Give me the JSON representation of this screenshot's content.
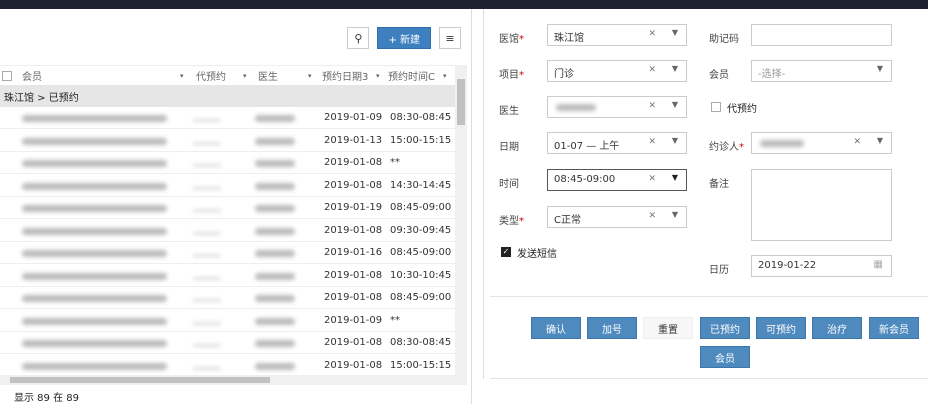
{
  "toolbar": {
    "new_label": "+ 新建"
  },
  "table": {
    "headers": [
      "会员",
      "代预约",
      "医生",
      "预约日期3",
      "预约时间C"
    ],
    "group": "珠江馆 > 已预约",
    "rows": [
      {
        "date": "2019-01-09",
        "time": "08:30-08:45"
      },
      {
        "date": "2019-01-13",
        "time": "15:00-15:15"
      },
      {
        "date": "2019-01-08",
        "time": "**"
      },
      {
        "date": "2019-01-08",
        "time": "14:30-14:45"
      },
      {
        "date": "2019-01-19",
        "time": "08:45-09:00"
      },
      {
        "date": "2019-01-08",
        "time": "09:30-09:45"
      },
      {
        "date": "2019-01-16",
        "time": "08:45-09:00"
      },
      {
        "date": "2019-01-08",
        "time": "10:30-10:45"
      },
      {
        "date": "2019-01-08",
        "time": "08:45-09:00"
      },
      {
        "date": "2019-01-09",
        "time": "**"
      },
      {
        "date": "2019-01-08",
        "time": "08:30-08:45"
      },
      {
        "date": "2019-01-08",
        "time": "15:00-15:15"
      }
    ],
    "footer": "显示 89 在 89"
  },
  "form": {
    "clinic_label": "医馆",
    "clinic_value": "珠江馆",
    "project_label": "项目",
    "project_value": "门诊",
    "doctor_label": "医生",
    "date_label": "日期",
    "date_value": "01-07 — 上午",
    "time_label": "时间",
    "time_value": "08:45-09:00",
    "type_label": "类型",
    "type_value": "C正常",
    "sms_label": "发送短信",
    "mnemonic_label": "助记码",
    "member_label": "会员",
    "member_placeholder": "-选择-",
    "proxy_label": "代预约",
    "booker_label": "约诊人",
    "note_label": "备注",
    "calendar_label": "日历",
    "calendar_value": "2019-01-22",
    "req": "*"
  },
  "buttons": [
    "确认",
    "加号",
    "重置",
    "已预约",
    "可预约",
    "治疗",
    "新会员",
    "会员"
  ]
}
